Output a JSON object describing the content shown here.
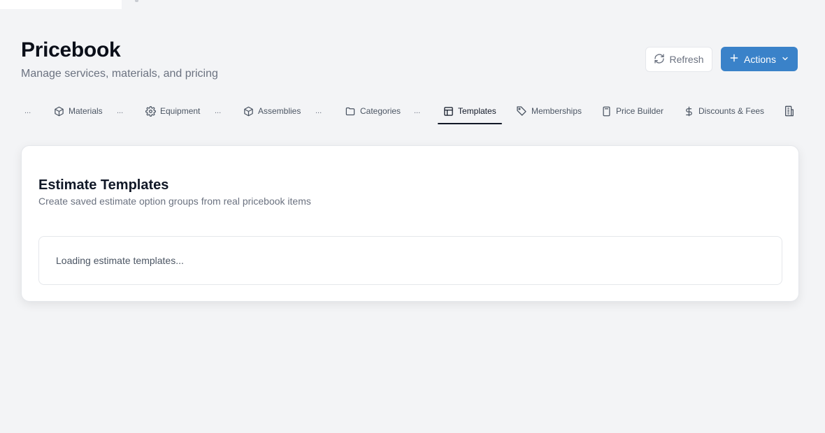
{
  "header": {
    "title": "Pricebook",
    "subtitle": "Manage services, materials, and pricing",
    "refresh_label": "Refresh",
    "actions_label": "Actions"
  },
  "tabs": {
    "overflow_marker": "...",
    "items": [
      {
        "label": "Materials",
        "icon": "cube-icon"
      },
      {
        "label": "Equipment",
        "icon": "gear-icon"
      },
      {
        "label": "Assemblies",
        "icon": "cube-icon"
      },
      {
        "label": "Categories",
        "icon": "folder-icon"
      },
      {
        "label": "Templates",
        "icon": "layout-template-icon",
        "active": true
      },
      {
        "label": "Memberships",
        "icon": "tag-icon"
      },
      {
        "label": "Price Builder",
        "icon": "calculator-icon"
      },
      {
        "label": "Discounts & Fees",
        "icon": "dollar-icon"
      }
    ]
  },
  "card": {
    "title": "Estimate Templates",
    "subtitle": "Create saved estimate option groups from real pricebook items",
    "loading_text": "Loading estimate templates..."
  },
  "colors": {
    "accent": "#3a82c9",
    "background": "#f3f4f6",
    "active_tab_underline": "#111827"
  }
}
